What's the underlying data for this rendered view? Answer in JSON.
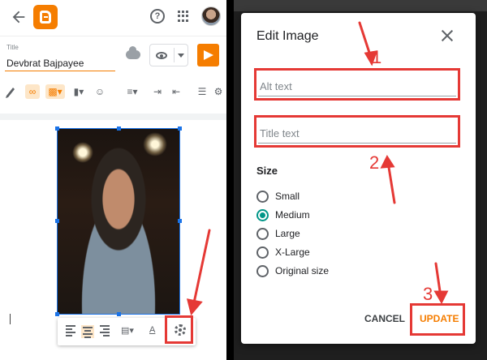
{
  "editor": {
    "title_label": "Title",
    "title_value": "Devbrat Bajpayee"
  },
  "dialog": {
    "title": "Edit Image",
    "alt_placeholder": "Alt text",
    "title_placeholder": "Title text",
    "size_label": "Size",
    "size_options": [
      "Small",
      "Medium",
      "Large",
      "X-Large",
      "Original size"
    ],
    "selected_size": "Medium",
    "cancel_label": "CANCEL",
    "update_label": "UPDATE"
  },
  "annotations": {
    "step1": "1",
    "step2": "2",
    "step3": "3",
    "color": "#e53935"
  },
  "colors": {
    "accent": "#f57d00",
    "radio_selected": "#009688",
    "selection": "#1a73e8"
  },
  "icons": [
    "back-arrow-icon",
    "blogger-logo",
    "help-icon",
    "apps-icon",
    "cloud-saved-icon",
    "eye-icon",
    "send-icon",
    "pen-icon",
    "link-icon",
    "image-icon",
    "video-icon",
    "emoji-icon",
    "align-icon",
    "indent-icon",
    "outdent-icon",
    "list-icon",
    "gear-icon",
    "close-icon"
  ]
}
